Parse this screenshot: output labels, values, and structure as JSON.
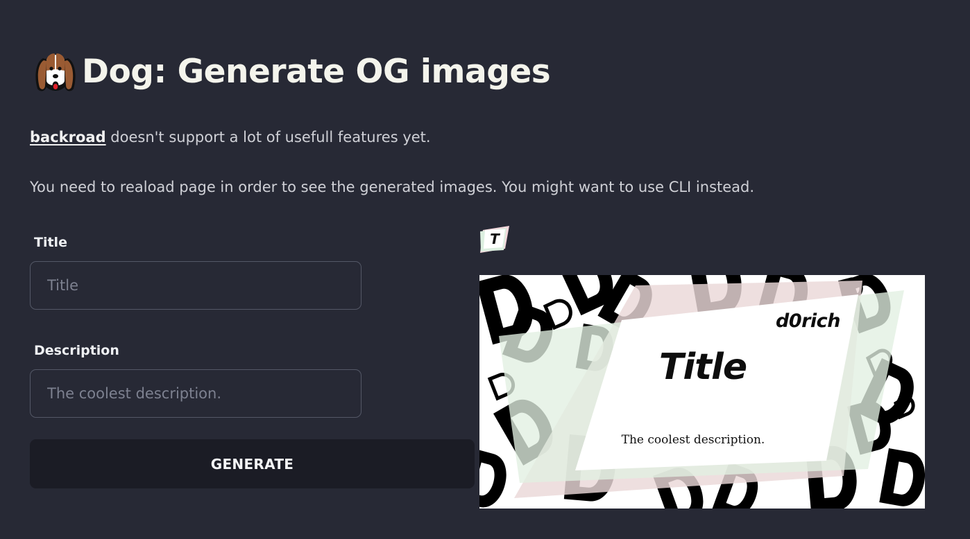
{
  "header": {
    "title": "Dog: Generate OG images",
    "icon": "dog-face-icon"
  },
  "intro": {
    "link_text": "backroad",
    "line_1_rest": " doesn't support a lot of usefull features yet.",
    "line_2": "You need to reaload page in order to see the generated images. You might want to use CLI instead."
  },
  "form": {
    "title_label": "Title",
    "title_placeholder": "Title",
    "title_value": "",
    "description_label": "Description",
    "description_placeholder": "The coolest description.",
    "description_value": "",
    "generate_label": "GENERATE"
  },
  "preview": {
    "template_thumb_icon": "template-t-icon",
    "template_letter": "T",
    "brand": "d0rich",
    "title": "Title",
    "description": "The coolest description."
  },
  "colors": {
    "background": "#272935",
    "button_background": "#1b1c25",
    "heading_text": "#f4f4ec",
    "card_pink": "#ead8d8",
    "card_green": "#e1efe2"
  }
}
